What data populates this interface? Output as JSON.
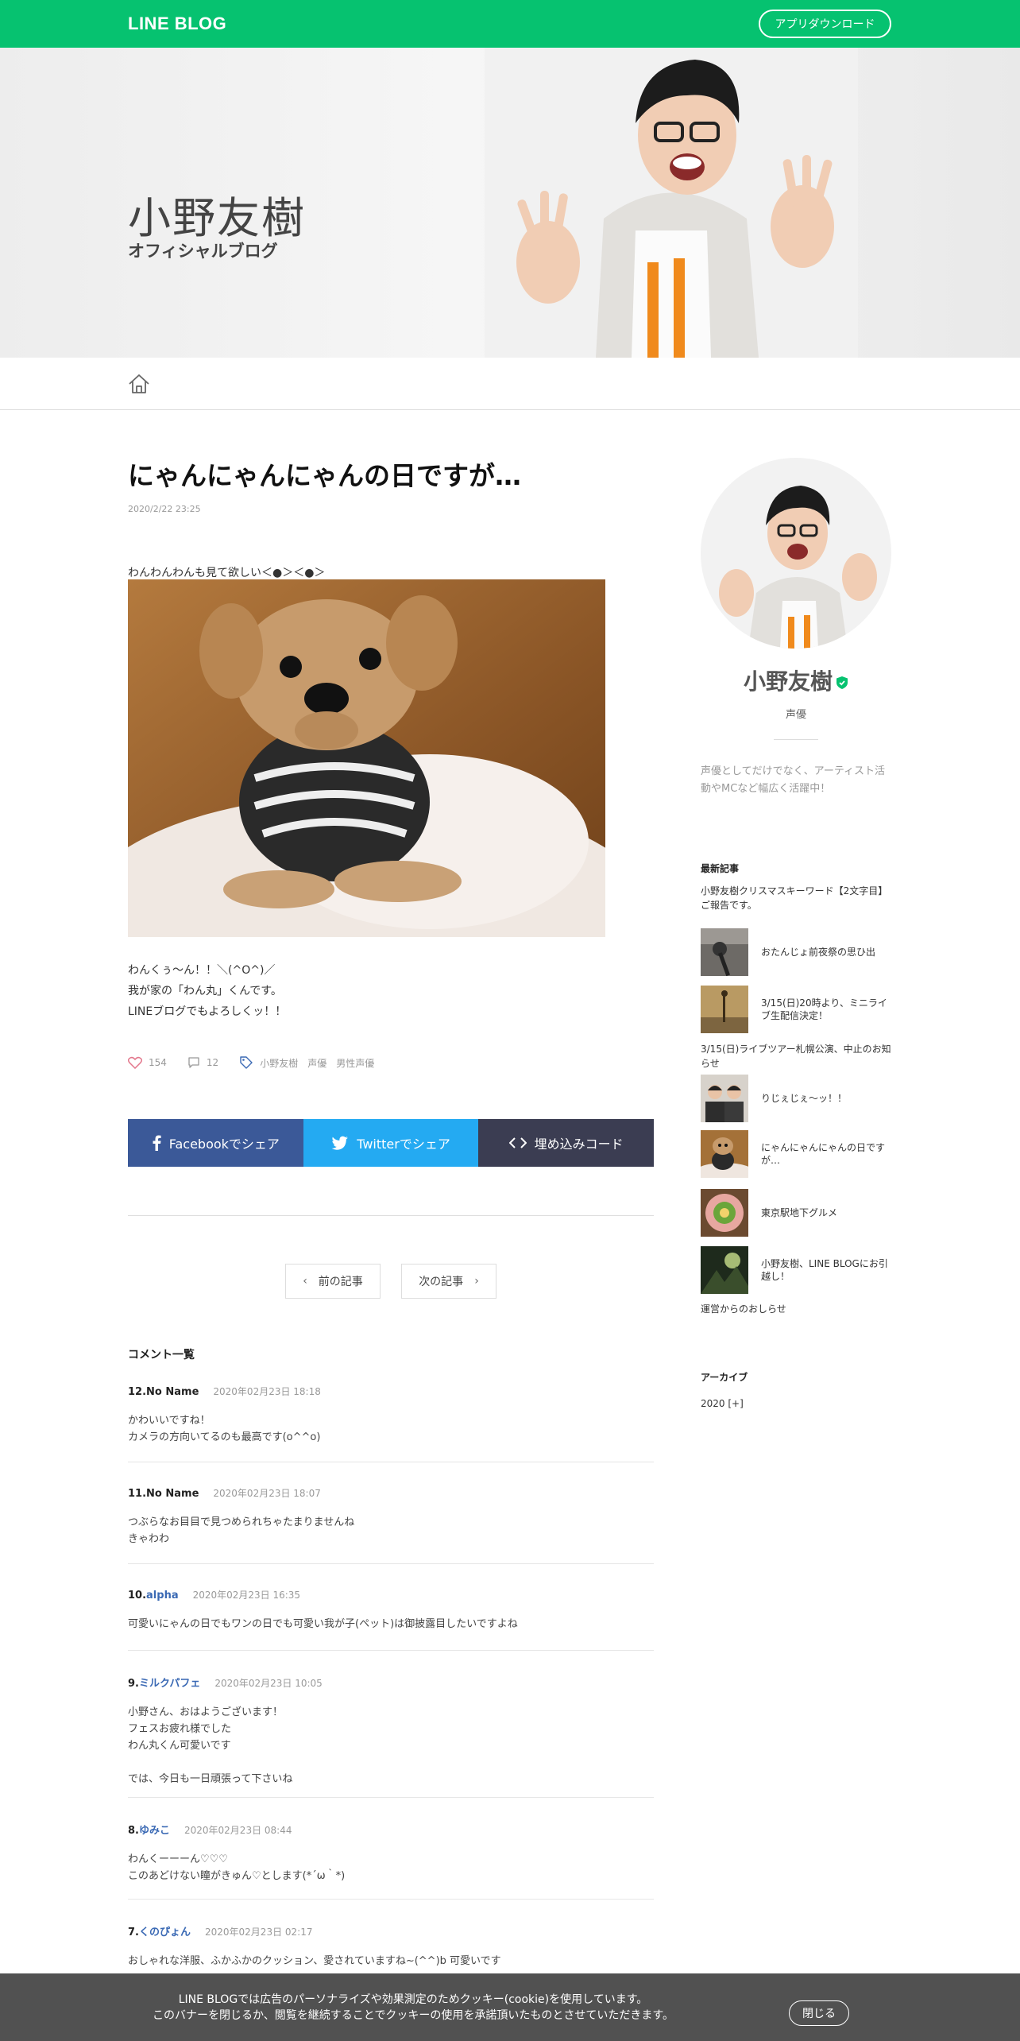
{
  "header": {
    "logo": "LINE BLOG",
    "app_download": "アプリダウンロード"
  },
  "hero": {
    "name": "小野友樹",
    "subtitle": "オフィシャルブログ"
  },
  "article": {
    "title": "にゃんにゃんにゃんの日ですが…",
    "date": "2020/2/22 23:25",
    "lead": "わんわんわんも見て欲しい＜●＞＜●＞",
    "body_lines": [
      "わんくぅ〜ん！！＼(^O^)／",
      "我が家の「わん丸」くんです。",
      "LINEブログでもよろしくッ！！"
    ],
    "likes": "154",
    "comments": "12",
    "tags": [
      "小野友樹",
      "声優",
      "男性声優"
    ]
  },
  "share": {
    "facebook": "Facebookでシェア",
    "twitter": "Twitterでシェア",
    "embed": "埋め込みコード"
  },
  "pager": {
    "prev": "前の記事",
    "next": "次の記事"
  },
  "comments_title": "コメント一覧",
  "comments": [
    {
      "num": "12.",
      "name": "No Name",
      "date": "2020年02月23日 18:18",
      "body": "かわいいですね！\nカメラの方向いてるのも最高です(o^^o)"
    },
    {
      "num": "11.",
      "name": "No Name",
      "date": "2020年02月23日 18:07",
      "body": "つぶらなお目目で見つめられちゃたまりませんね\nきゃわわ"
    },
    {
      "num": "10.",
      "name": "alpha",
      "date": "2020年02月23日 16:35",
      "body": "可愛いにゃんの日でもワンの日でも可愛い我が子(ペット)は御披露目したいですよね"
    },
    {
      "num": "9.",
      "name": "ミルクパフェ",
      "date": "2020年02月23日 10:05",
      "body": "小野さん、おはようございます！\nフェスお疲れ様でした\nわん丸くん可愛いです\n\nでは、今日も一日頑張って下さいね"
    },
    {
      "num": "8.",
      "name": "ゆみこ",
      "date": "2020年02月23日 08:44",
      "body": "わんくーーーん♡♡♡\nこのあどけない瞳がきゅん♡とします(*´ω｀*)"
    },
    {
      "num": "7.",
      "name": "くのぴょん",
      "date": "2020年02月23日 02:17",
      "body": "おしゃれな洋服、ふかふかのクッション、愛されていますね~(^^)b 可愛いです"
    }
  ],
  "sidebar": {
    "name": "小野友樹",
    "role": "声優",
    "description": "声優としてだけでなく、アーティスト活動やMCなど幅広く活躍中！",
    "latest_heading": "最新記事",
    "latest_text_top": "小野友樹クリスマスキーワード【2文字目】ご報告です。",
    "entries": [
      {
        "title": "おたんじょ前夜祭の思ひ出",
        "icon": "microphone-photo"
      },
      {
        "title": "3/15(日)20時より、ミニライブ生配信決定！",
        "icon": "stage-photo"
      }
    ],
    "latest_text_mid": "3/15(日)ライブツアー札幌公演、中止のお知らせ",
    "entries2": [
      {
        "title": "りじぇじぇ〜ッ！！",
        "icon": "duo-photo"
      },
      {
        "title": "にゃんにゃんにゃんの日ですが…",
        "icon": "dog-photo"
      },
      {
        "title": "東京駅地下グルメ",
        "icon": "food-photo"
      },
      {
        "title": "小野友樹、LINE BLOGにお引越し！",
        "icon": "light-photo"
      }
    ],
    "latest_text_bottom": "運営からのおしらせ",
    "archive_heading": "アーカイブ",
    "archive_item": "2020 [+]"
  },
  "cookie": {
    "line1": "LINE BLOGでは広告のパーソナライズや効果測定のためクッキー(cookie)を使用しています。",
    "line2": "このバナーを閉じるか、閲覧を継続することでクッキーの使用を承諾頂いたものとさせていただきます。",
    "close": "閉じる"
  },
  "colors": {
    "brand_green": "#06c270",
    "facebook": "#3b5998",
    "twitter": "#24aaf2",
    "embed": "#3b3d52",
    "link_blue": "#3a69b4"
  }
}
